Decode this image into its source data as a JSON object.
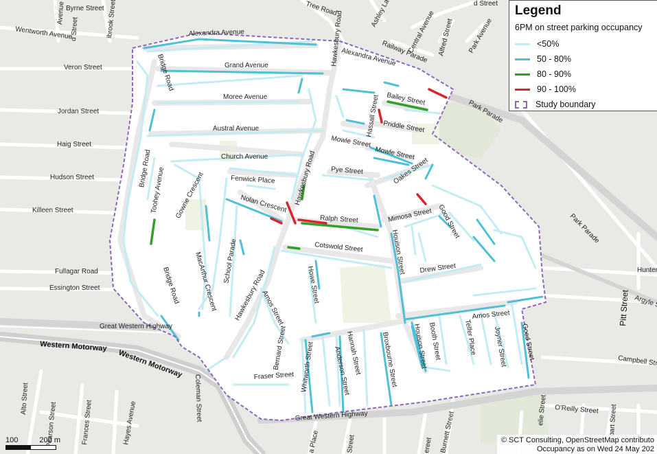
{
  "legend": {
    "title": "Legend",
    "subtitle": "6PM on street parking occupancy",
    "items": [
      {
        "label": "<50%",
        "color": "#c4ecf3"
      },
      {
        "label": "50 - 80%",
        "color": "#4fc0d6"
      },
      {
        "label": "80 - 90%",
        "color": "#33a02c"
      },
      {
        "label": "90 - 100%",
        "color": "#d6262e"
      }
    ],
    "boundary_label": "Study boundary",
    "boundary_color": "#8b68b5"
  },
  "colors": {
    "background": "#e9e9e6",
    "study_area": "#ffffff",
    "park": "#eef3e3",
    "minor_road": "#ffffff",
    "major_road": "#d8d8d8"
  },
  "attribution": {
    "line1": "© SCT Consulting, OpenStreetMap contributo",
    "line2": "Occupancy as on Wed 24 May 202"
  },
  "scale": {
    "start": "100",
    "end": "200 m"
  },
  "labels": {
    "byrne": "Byrne Street",
    "wentworth": "Wentworth Avenue",
    "veron": "Veron Street",
    "jordan": "Jordan Street",
    "haig": "Haig Street",
    "hudson": "Hudson Street",
    "killeen": "Killeen Street",
    "fullagar": "Fullagar Road",
    "essington": "Essington Street",
    "gwh_top": "Great Western Highway",
    "wm1": "Western Motorway",
    "wm2": "Western Motorway",
    "alexandra_ave": "Alexandra Avenue",
    "alexandra_ave2": "Alexandra Avenue",
    "grand": "Grand Avenue",
    "moree": "Moree Avenue",
    "austral": "Austral Avenue",
    "church": "Church Avenue",
    "fenwick": "Fenwick Place",
    "nolan": "Nolan Crescent",
    "ralph": "Ralph Street",
    "cotswold": "Cotswold Street",
    "pye": "Pye Street",
    "mowle1": "Mowle Street",
    "mowle2": "Mowle Street",
    "bailey": "Bailey Street",
    "priddle": "Priddle Street",
    "hassall": "Hassall Street",
    "oakes": "Oakes Street",
    "mimosa": "Mimosa Street",
    "good1": "Good Street",
    "good2": "Good Street",
    "drew": "Drew Street",
    "amos_e": "Amos Street",
    "amos_w": "Amos Street",
    "houison1": "Houison Street",
    "houison2": "Houison Street",
    "booth": "Booth Street",
    "telfer": "Telfer Place",
    "joyner": "Joyner Street",
    "broxbourne": "Broxbourne Street",
    "hannah": "Hannah Street",
    "anderson": "Anderson Street",
    "whitworth": "Whitworth Street",
    "bernard": "Bernard Street",
    "fraser": "Fraser Street",
    "howe": "Howe Street",
    "hawk_top": "Hawkesbury Road",
    "hawk_mid": "Hawkesbury Road",
    "hawk_low": "Hawkesbury Road",
    "bridge1": "Bridge Road",
    "bridge2": "Bridge Road",
    "bridge3": "Bridge Road",
    "toohey": "Toohey Avenue",
    "gowrie": "Gowrie Crescent",
    "macarthur": "MacArthur Crescent",
    "school": "School Parade",
    "coleman": "Coleman Street",
    "gwh_bottom": "Great Western Highway",
    "park_parade1": "Park Parade",
    "park_parade2": "Park Parade",
    "park_ave": "Park Avenue",
    "railway": "Railway Parade",
    "central": "Central Avenue",
    "alfred": "Alfred Street",
    "ashley": "Ashley La",
    "tree": "Tree Road",
    "pitt": "Pitt Street",
    "argyle": "Argyle S",
    "hunter": "Hunter",
    "campbell": "Campbell Street",
    "oreilly": "O'Reilly Street",
    "alto": "Alto Street",
    "pearson": "Pearson Street",
    "frances": "Frances Street",
    "hayes": "Hayes Avenue",
    "avenue_tl": "Avenue",
    "brook": "ibrook Street",
    "burnett": "Burnett Street",
    "place_b": "a Place",
    "street_b": "Street",
    "street_b2": "ereet",
    "elie": "elie Street",
    "hobart": "Hobart Street",
    "street_tl": "d Street",
    "street_tl2": "d Street"
  }
}
